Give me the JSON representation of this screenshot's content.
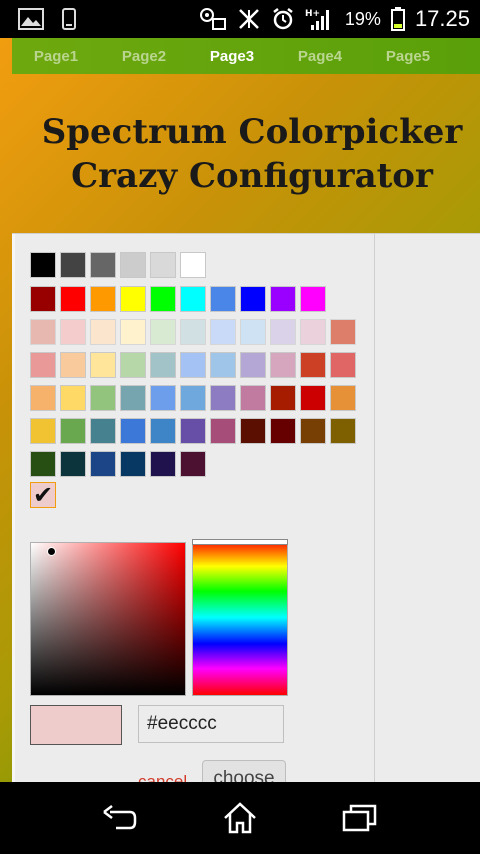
{
  "status_bar": {
    "battery_percent": "19%",
    "time": "17.25",
    "signal_label": "H+",
    "icons_left": [
      "image-icon",
      "phone-device-icon"
    ],
    "icons_right": [
      "usb-debug-icon",
      "no-network-icon",
      "alarm-icon",
      "signal-icon",
      "battery-icon"
    ]
  },
  "tabs": [
    "Page1",
    "Page2",
    "Page3",
    "Page4",
    "Page5"
  ],
  "active_tab": "Page3",
  "title_line1": "Spectrum Colorpicker",
  "title_line2": "Crazy Configurator",
  "palette": [
    [
      "#000000",
      "#434343",
      "#666666",
      "#cccccc",
      "#d9d9d9",
      "#ffffff"
    ],
    [
      "#980000",
      "#ff0000",
      "#ff9900",
      "#ffff00",
      "#00ff00",
      "#00ffff",
      "#4a86e8",
      "#0000ff",
      "#9900ff",
      "#ff00ff"
    ],
    [
      "#e6b8af",
      "#f4cccc",
      "#fce5cd",
      "#fff2cc",
      "#d9ead3",
      "#d0e0e3",
      "#c9daf8",
      "#cfe2f3",
      "#d9d2e9",
      "#ead1dc",
      "#dd7e6b"
    ],
    [
      "#ea9999",
      "#f9cb9c",
      "#ffe599",
      "#b6d7a8",
      "#a2c4c9",
      "#a4c2f4",
      "#9fc5e8",
      "#b4a7d6",
      "#d5a6bd",
      "#cc4125",
      "#e06666"
    ],
    [
      "#f6b26b",
      "#ffd966",
      "#93c47d",
      "#76a5af",
      "#6d9eeb",
      "#6fa8dc",
      "#8e7cc3",
      "#c27ba0",
      "#a61c00",
      "#cc0000",
      "#e69138"
    ],
    [
      "#f1c232",
      "#6aa84f",
      "#45818e",
      "#3c78d8",
      "#3d85c6",
      "#674ea7",
      "#a64d79",
      "#5b0f00",
      "#660000",
      "#783f04",
      "#7f6000"
    ],
    [
      "#274e13",
      "#0c343d",
      "#1c4587",
      "#073763",
      "#20124d",
      "#4c1130"
    ]
  ],
  "selected_color": "#eecccc",
  "hex_value": "#eecccc",
  "cancel_label": "cancel",
  "choose_label": "choose",
  "nav": [
    "back-icon",
    "home-icon",
    "recent-apps-icon"
  ]
}
